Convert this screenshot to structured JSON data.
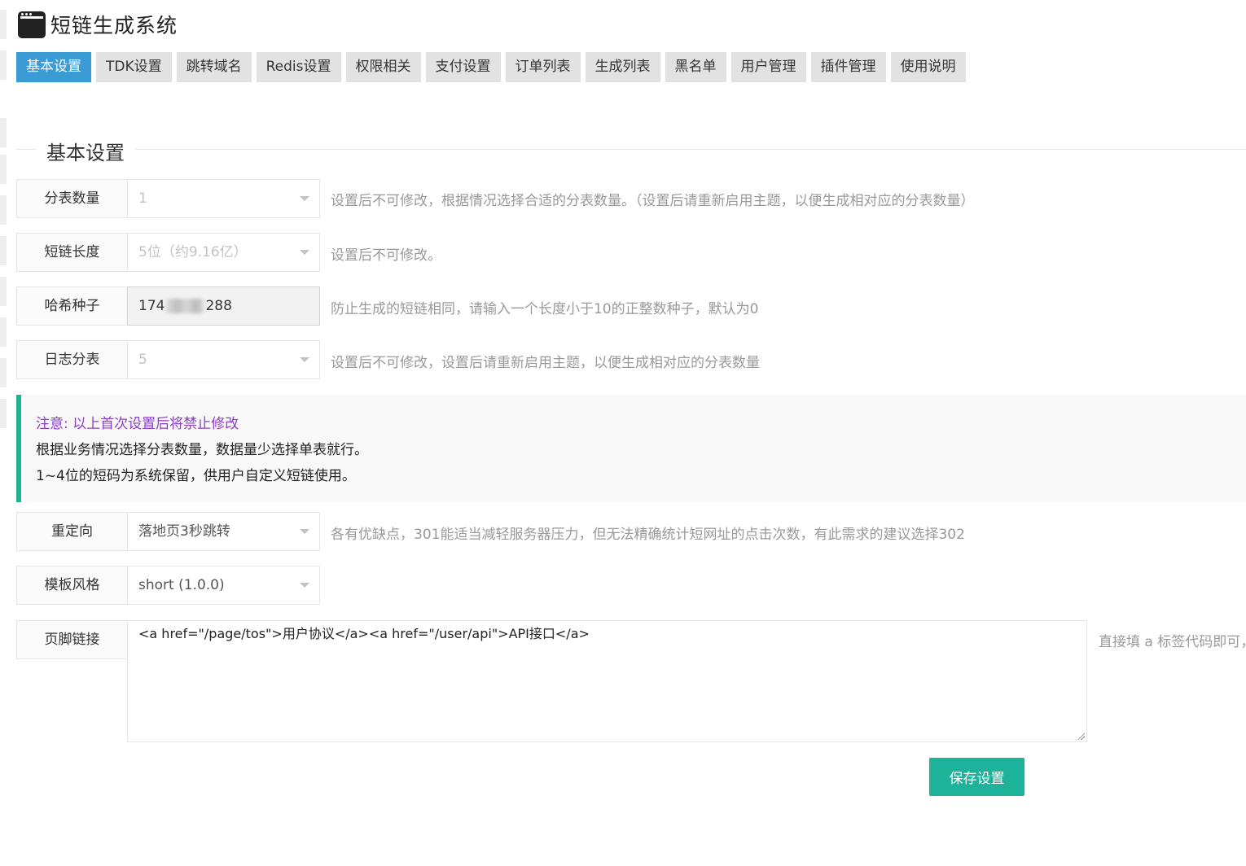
{
  "app": {
    "title": "短链生成系统",
    "icon": "app-window-icon"
  },
  "tabs": [
    {
      "label": "基本设置",
      "active": true
    },
    {
      "label": "TDK设置"
    },
    {
      "label": "跳转域名"
    },
    {
      "label": "Redis设置"
    },
    {
      "label": "权限相关"
    },
    {
      "label": "支付设置"
    },
    {
      "label": "订单列表"
    },
    {
      "label": "生成列表"
    },
    {
      "label": "黑名单"
    },
    {
      "label": "用户管理"
    },
    {
      "label": "插件管理"
    },
    {
      "label": "使用说明"
    }
  ],
  "section": {
    "title": "基本设置"
  },
  "fields": {
    "table_count": {
      "label": "分表数量",
      "value": "1",
      "hint": "设置后不可修改，根据情况选择合适的分表数量。（设置后请重新启用主题，以便生成相对应的分表数量）"
    },
    "short_length": {
      "label": "短链长度",
      "value": "5位（约9.16亿）",
      "hint": "设置后不可修改。"
    },
    "hash_seed": {
      "label": "哈希种子",
      "value_prefix": "174",
      "value_suffix": "288",
      "hint": "防止生成的短链相同，请输入一个长度小于10的正整数种子，默认为0"
    },
    "log_table": {
      "label": "日志分表",
      "value": "5",
      "hint": "设置后不可修改，设置后请重新启用主题，以便生成相对应的分表数量"
    },
    "redirect": {
      "label": "重定向",
      "value": "落地页3秒跳转",
      "hint": "各有优缺点，301能适当减轻服务器压力，但无法精确统计短网址的点击次数，有此需求的建议选择302"
    },
    "template": {
      "label": "模板风格",
      "value": "short (1.0.0)"
    },
    "footer_links": {
      "label": "页脚链接",
      "value": "<a href=\"/page/tos\">用户协议</a><a href=\"/user/api\">API接口</a>",
      "hint": "直接填 a 标签代码即可，"
    }
  },
  "notice": {
    "warning": "注意: 以上首次设置后将禁止修改",
    "lines": [
      "根据业务情况选择分表数量，数据量少选择单表就行。",
      "1~4位的短码为系统保留，供用户自定义短链使用。"
    ]
  },
  "save_label": "保存设置",
  "colors": {
    "accent": "#3a9bd5",
    "success": "#1db39b",
    "notice_border": "#1fb394",
    "warning_text": "#8a3fc4"
  }
}
